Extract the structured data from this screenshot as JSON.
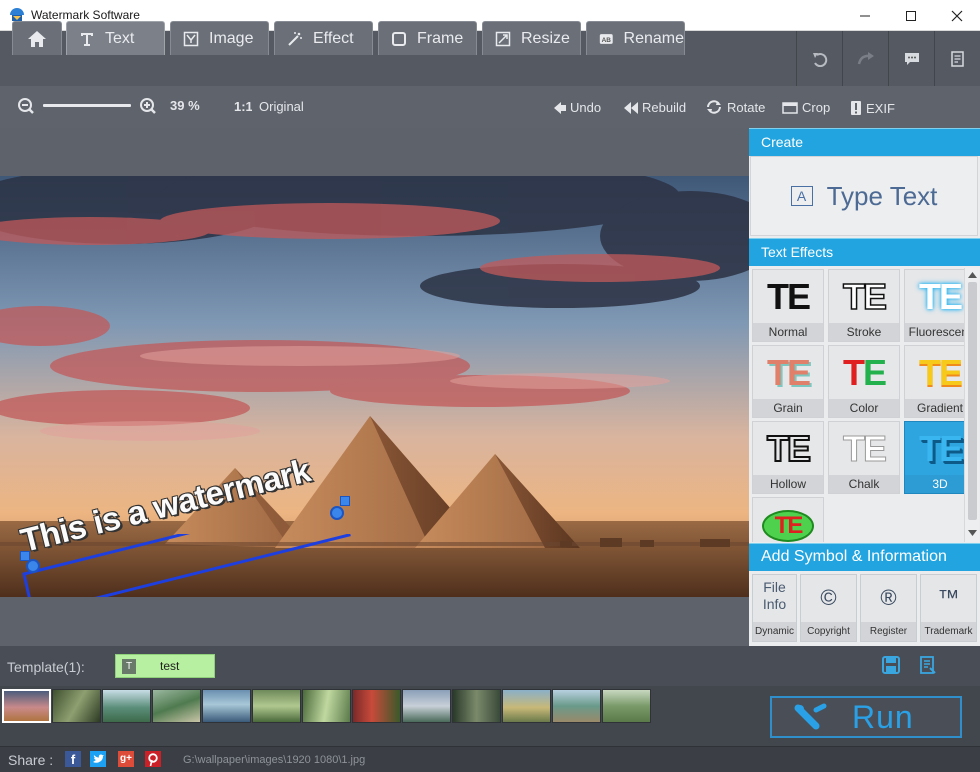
{
  "window": {
    "title": "Watermark Software"
  },
  "tabs": [
    {
      "label": ""
    },
    {
      "label": "Text"
    },
    {
      "label": "Image"
    },
    {
      "label": "Effect"
    },
    {
      "label": "Frame"
    },
    {
      "label": "Resize"
    },
    {
      "label": "Rename"
    }
  ],
  "toolbar": {
    "zoom": "39 %",
    "original": "Original",
    "undo": "Undo",
    "rebuild": "Rebuild",
    "rotate": "Rotate",
    "crop": "Crop",
    "exif": "EXIF"
  },
  "watermark": {
    "text": "This is a watermark"
  },
  "panel": {
    "create_header": "Create",
    "type_text": "Type Text",
    "type_text_icon": "A",
    "effects_header": "Text Effects",
    "effects": [
      {
        "label": "Normal",
        "glyph": "TE"
      },
      {
        "label": "Stroke",
        "glyph": "TE"
      },
      {
        "label": "Fluorescent",
        "glyph": "TE"
      },
      {
        "label": "Grain",
        "glyph": "TE"
      },
      {
        "label": "Color",
        "glyph": "TE"
      },
      {
        "label": "Gradient",
        "glyph": "TE"
      },
      {
        "label": "Hollow",
        "glyph": "TE"
      },
      {
        "label": "Chalk",
        "glyph": "TE"
      },
      {
        "label": "3D",
        "glyph": "TE"
      },
      {
        "label": "",
        "glyph": "TE"
      }
    ],
    "symbol_header": "Add Symbol & Information",
    "symbols": [
      {
        "icon": "File Info",
        "label": "Dynamic"
      },
      {
        "icon": "©",
        "label": "Copyright"
      },
      {
        "icon": "®",
        "label": "Register"
      },
      {
        "icon": "™",
        "label": "Trademark"
      }
    ]
  },
  "template": {
    "label": "Template(1):",
    "item": "test",
    "item_icon": "T"
  },
  "run_label": "Run",
  "status": {
    "share": "Share :",
    "path": "G:\\wallpaper\\images\\1920 1080\\1.jpg"
  },
  "colors": {
    "accent": "#21a4df",
    "selected": "#2fa5df",
    "handle": "#1e6fd6",
    "template_bg": "#b7f0a0"
  }
}
